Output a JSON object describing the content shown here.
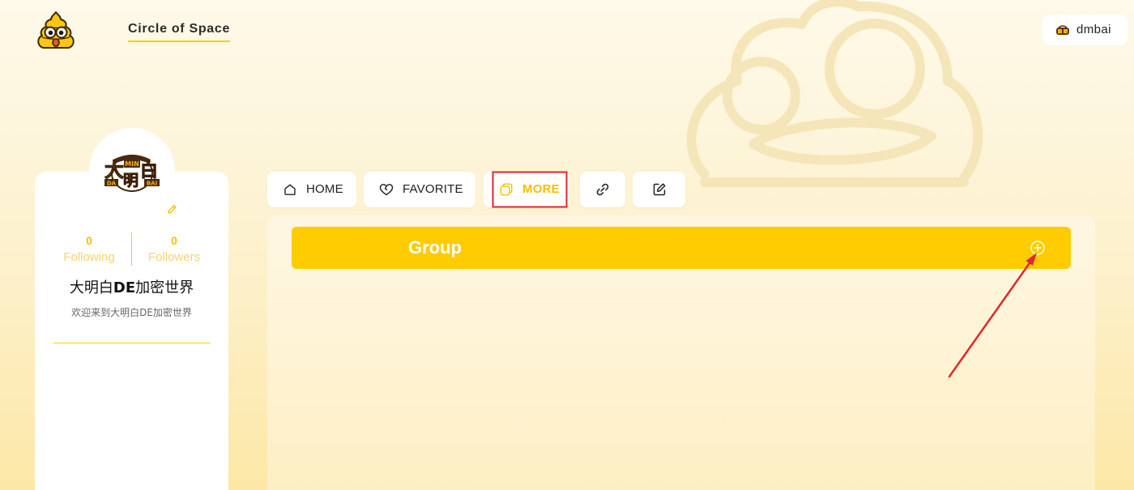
{
  "header": {
    "logo_icon": "mascot-logo-icon",
    "nav": {
      "label": "Circle of Space",
      "active": true
    },
    "user": {
      "avatar_icon": "user-avatar-icon",
      "name": "dmbai"
    }
  },
  "watermark_icon": "mascot-watermark-icon",
  "profile": {
    "avatar_logo": {
      "char_da": "大",
      "char_ming": "明",
      "char_bai": "白",
      "latin_min": "MIN",
      "latin_da": "DA",
      "latin_bai": "BAI"
    },
    "edit_icon": "pencil-icon",
    "stats": [
      {
        "count": "0",
        "label": "Following"
      },
      {
        "count": "0",
        "label": "Followers"
      }
    ],
    "name": {
      "prefix": "大明白",
      "bold": "DE",
      "suffix": "加密世界"
    },
    "bio": "欢迎来到大明白DE加密世界"
  },
  "tabs": [
    {
      "label": "HOME",
      "icon": "home-icon",
      "active": false
    },
    {
      "label": "FAVORITE",
      "icon": "heart-icon",
      "active": false
    },
    {
      "label": "MORE",
      "icon": "more-icon",
      "active": true
    },
    {
      "icon": "link-icon",
      "active": false
    },
    {
      "icon": "edit-icon",
      "active": false
    }
  ],
  "group": {
    "title": "Group",
    "add_icon": "plus-circle-icon"
  },
  "colors": {
    "accent": "#ffcc00",
    "accent_text": "#f5c000",
    "text": "#222222",
    "muted": "#666666",
    "card": "#ffffff",
    "annotation": "#e3262a"
  }
}
